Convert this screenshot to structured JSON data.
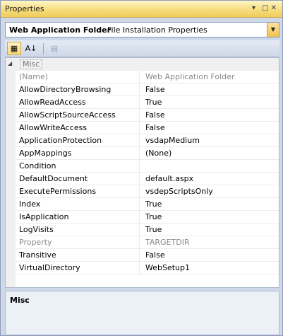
{
  "window": {
    "title": "Properties",
    "pin_glyph": "▾",
    "close_glyph": "□ ✕"
  },
  "object_selector": {
    "name": "Web Application Folder",
    "type": "File Installation Properties",
    "dropdown_glyph": "▼"
  },
  "toolbar": {
    "categorized_glyph": "▦",
    "alphabetical_glyph": "A↓",
    "property_pages_glyph": "▤"
  },
  "grid": {
    "category": {
      "expander": "◢",
      "label": "Misc"
    },
    "properties": [
      {
        "name": "(Name)",
        "value": "Web Application Folder",
        "readonly": true
      },
      {
        "name": "AllowDirectoryBrowsing",
        "value": "False"
      },
      {
        "name": "AllowReadAccess",
        "value": "True"
      },
      {
        "name": "AllowScriptSourceAccess",
        "value": "False"
      },
      {
        "name": "AllowWriteAccess",
        "value": "False"
      },
      {
        "name": "ApplicationProtection",
        "value": "vsdapMedium"
      },
      {
        "name": "AppMappings",
        "value": "(None)"
      },
      {
        "name": "Condition",
        "value": ""
      },
      {
        "name": "DefaultDocument",
        "value": "default.aspx"
      },
      {
        "name": "ExecutePermissions",
        "value": "vsdepScriptsOnly"
      },
      {
        "name": "Index",
        "value": "True"
      },
      {
        "name": "IsApplication",
        "value": "True"
      },
      {
        "name": "LogVisits",
        "value": "True"
      },
      {
        "name": "Property",
        "value": "TARGETDIR",
        "readonly": true
      },
      {
        "name": "Transitive",
        "value": "False"
      },
      {
        "name": "VirtualDirectory",
        "value": "WebSetup1"
      }
    ]
  },
  "description": {
    "title": "Misc"
  }
}
